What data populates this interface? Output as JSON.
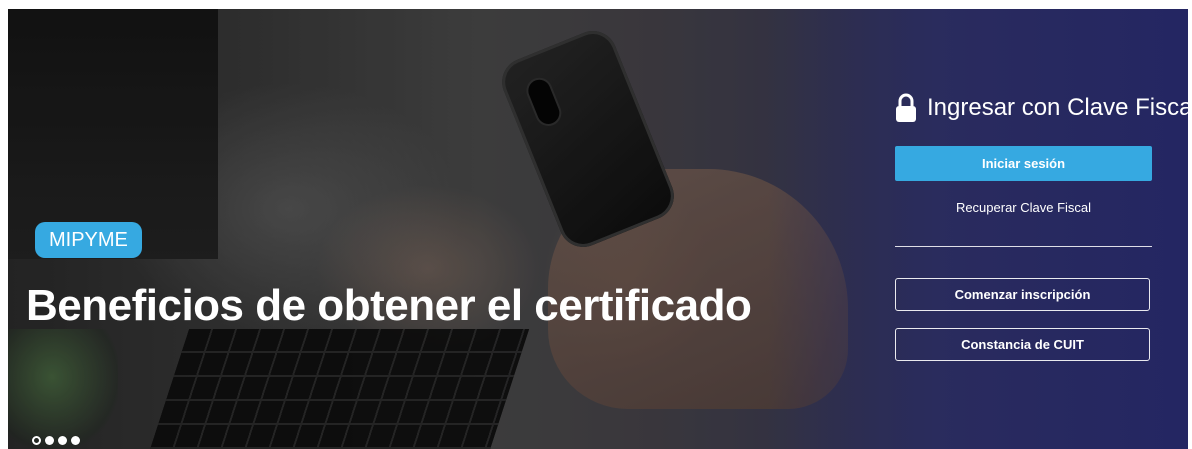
{
  "hero": {
    "badge": "MIPYME",
    "headline": "Beneficios de obtener el certificado",
    "carousel": {
      "slides": 4,
      "active_index": 0
    }
  },
  "login": {
    "title": "Ingresar con Clave Fiscal",
    "title_icon": "lock-icon",
    "primary_button": "Iniciar sesión",
    "recover_link": "Recuperar Clave Fiscal",
    "register_button": "Comenzar inscripción",
    "cuit_button": "Constancia de CUIT"
  },
  "colors": {
    "accent": "#36a9e1",
    "hero_right_tint": "#2d2f78",
    "text": "#ffffff"
  }
}
